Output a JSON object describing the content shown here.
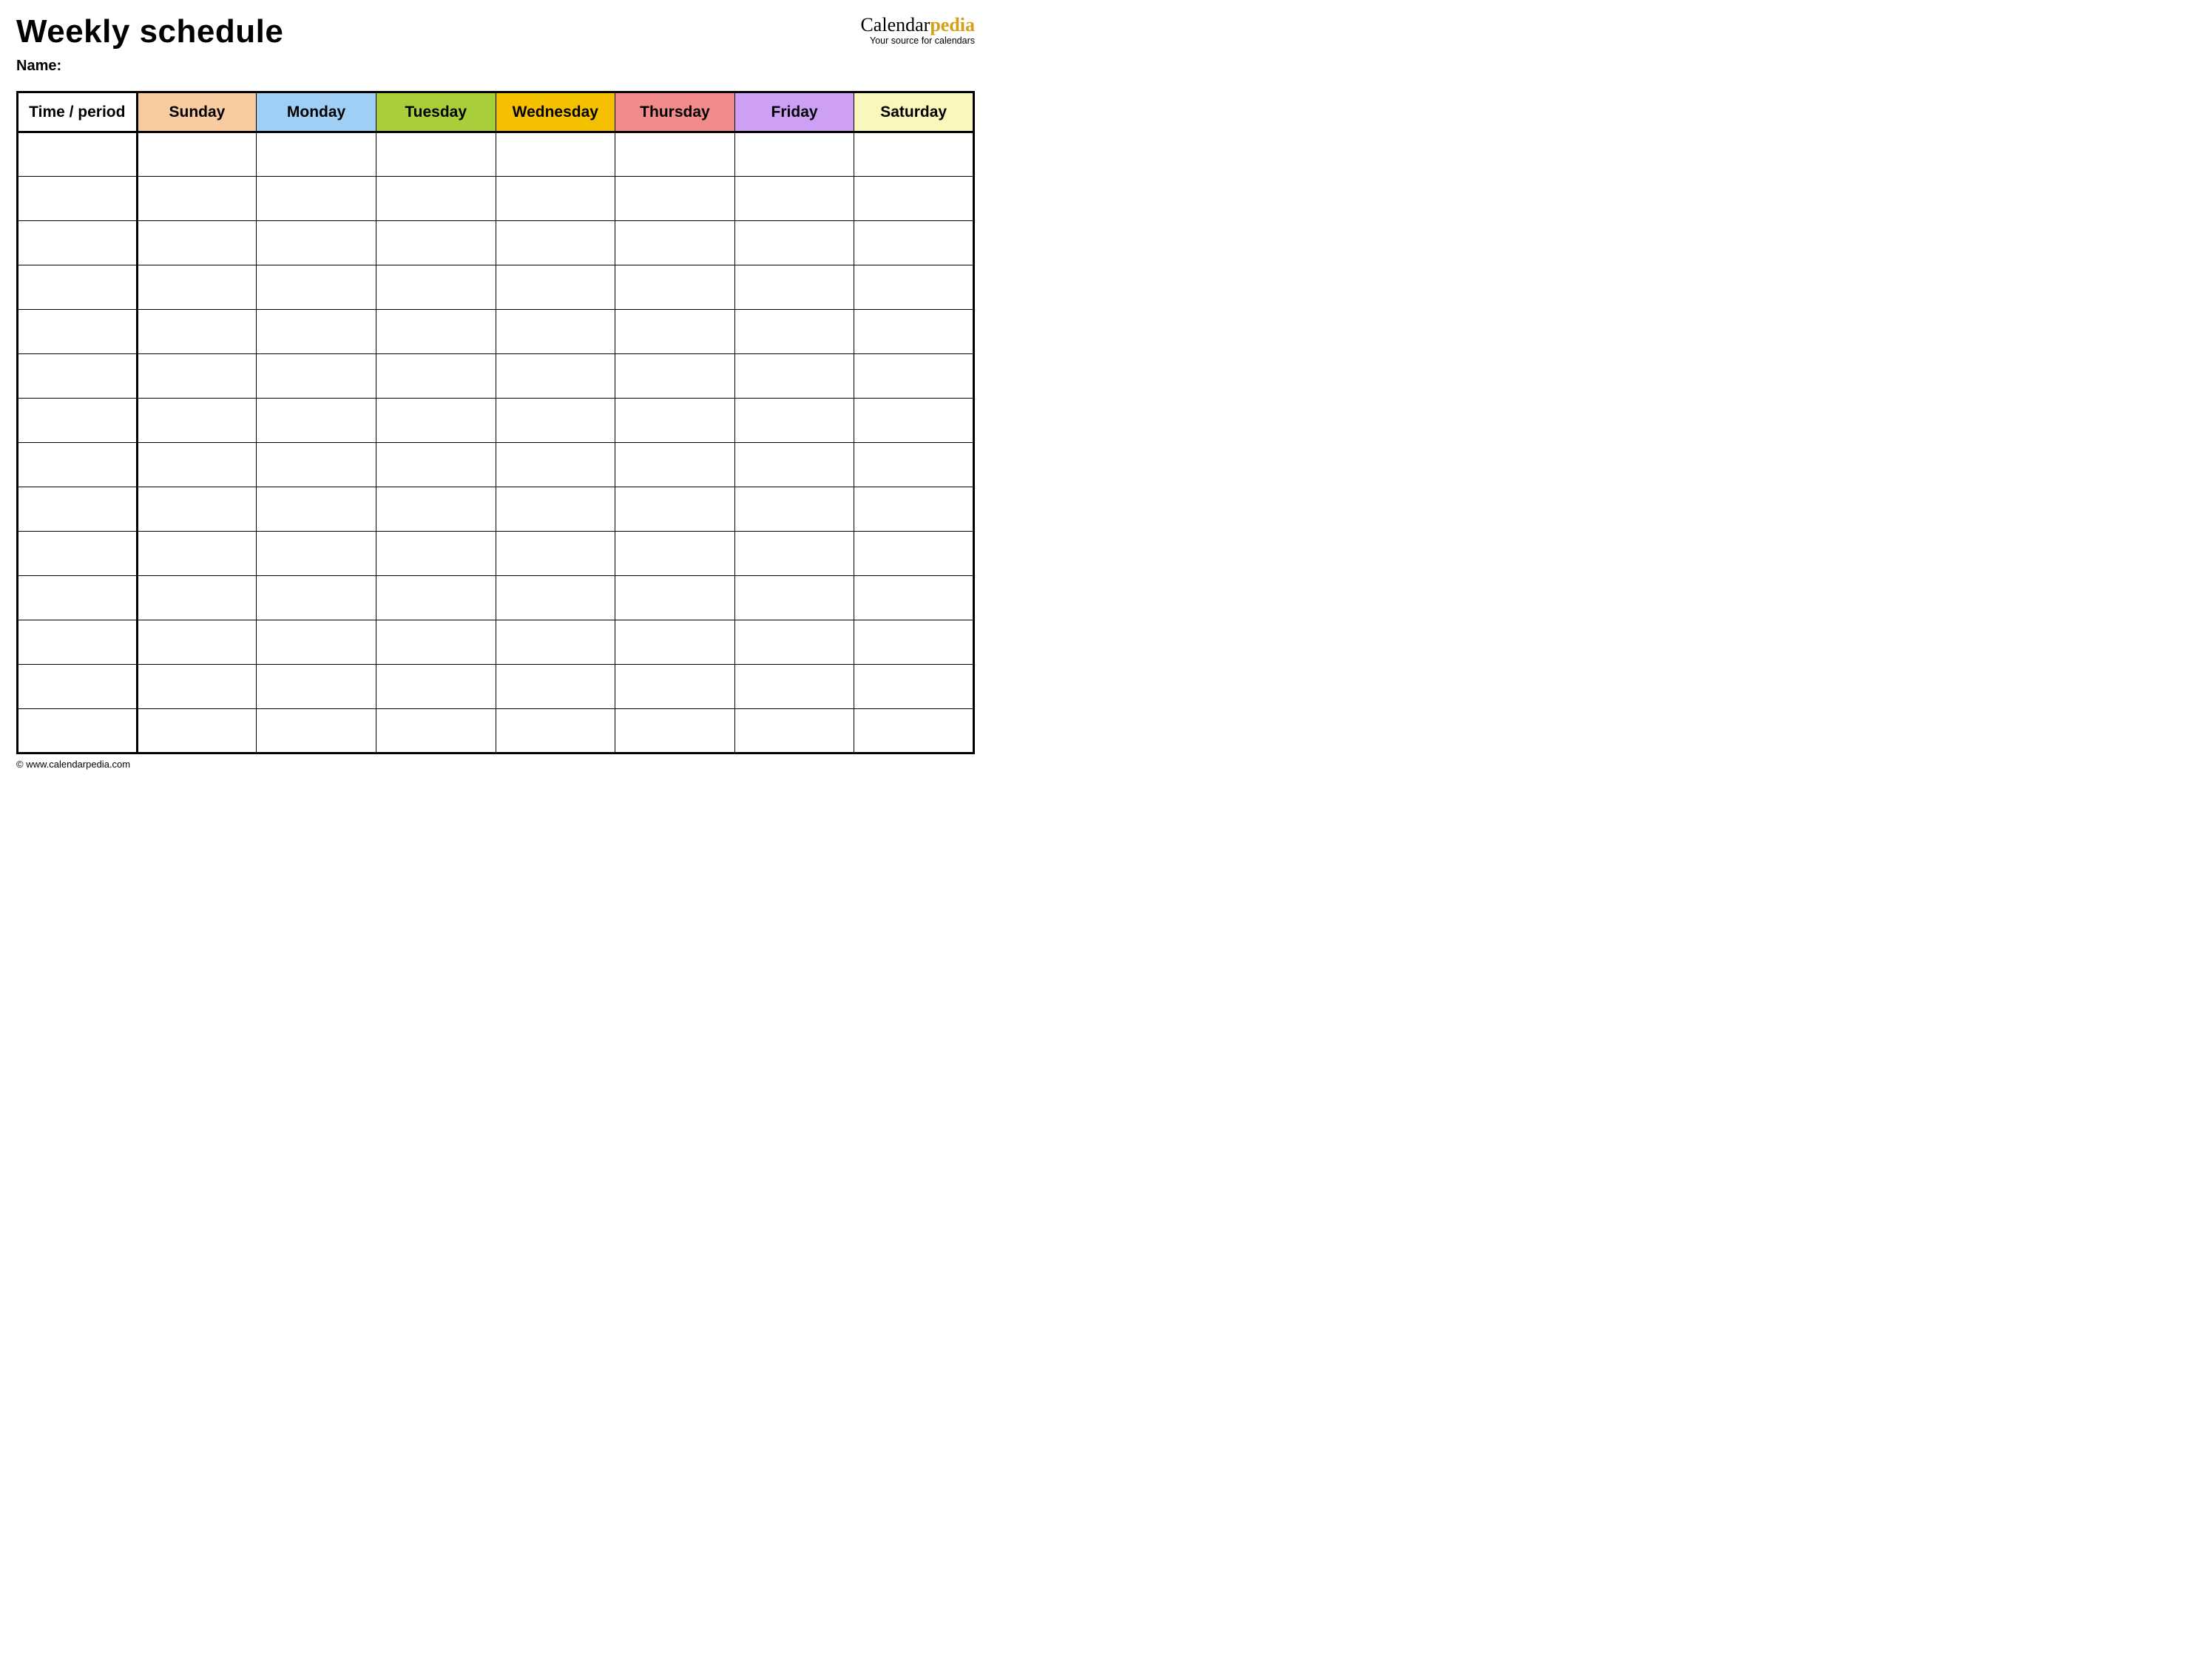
{
  "header": {
    "title": "Weekly schedule",
    "name_label": "Name:",
    "name_value": ""
  },
  "brand": {
    "name_part1": "Calendar",
    "name_part2": "pedia",
    "tagline": "Your source for calendars"
  },
  "table": {
    "time_header": "Time / period",
    "days": [
      {
        "label": "Sunday",
        "color": "#F8CBA0"
      },
      {
        "label": "Monday",
        "color": "#9FCFF5"
      },
      {
        "label": "Tuesday",
        "color": "#A8CF3B"
      },
      {
        "label": "Wednesday",
        "color": "#F5C000"
      },
      {
        "label": "Thursday",
        "color": "#F28B8B"
      },
      {
        "label": "Friday",
        "color": "#CDA0F5"
      },
      {
        "label": "Saturday",
        "color": "#F9F7BC"
      }
    ],
    "rows": [
      {
        "time": "",
        "cells": [
          "",
          "",
          "",
          "",
          "",
          "",
          ""
        ]
      },
      {
        "time": "",
        "cells": [
          "",
          "",
          "",
          "",
          "",
          "",
          ""
        ]
      },
      {
        "time": "",
        "cells": [
          "",
          "",
          "",
          "",
          "",
          "",
          ""
        ]
      },
      {
        "time": "",
        "cells": [
          "",
          "",
          "",
          "",
          "",
          "",
          ""
        ]
      },
      {
        "time": "",
        "cells": [
          "",
          "",
          "",
          "",
          "",
          "",
          ""
        ]
      },
      {
        "time": "",
        "cells": [
          "",
          "",
          "",
          "",
          "",
          "",
          ""
        ]
      },
      {
        "time": "",
        "cells": [
          "",
          "",
          "",
          "",
          "",
          "",
          ""
        ]
      },
      {
        "time": "",
        "cells": [
          "",
          "",
          "",
          "",
          "",
          "",
          ""
        ]
      },
      {
        "time": "",
        "cells": [
          "",
          "",
          "",
          "",
          "",
          "",
          ""
        ]
      },
      {
        "time": "",
        "cells": [
          "",
          "",
          "",
          "",
          "",
          "",
          ""
        ]
      },
      {
        "time": "",
        "cells": [
          "",
          "",
          "",
          "",
          "",
          "",
          ""
        ]
      },
      {
        "time": "",
        "cells": [
          "",
          "",
          "",
          "",
          "",
          "",
          ""
        ]
      },
      {
        "time": "",
        "cells": [
          "",
          "",
          "",
          "",
          "",
          "",
          ""
        ]
      },
      {
        "time": "",
        "cells": [
          "",
          "",
          "",
          "",
          "",
          "",
          ""
        ]
      }
    ]
  },
  "footer": {
    "copyright": "© www.calendarpedia.com"
  }
}
